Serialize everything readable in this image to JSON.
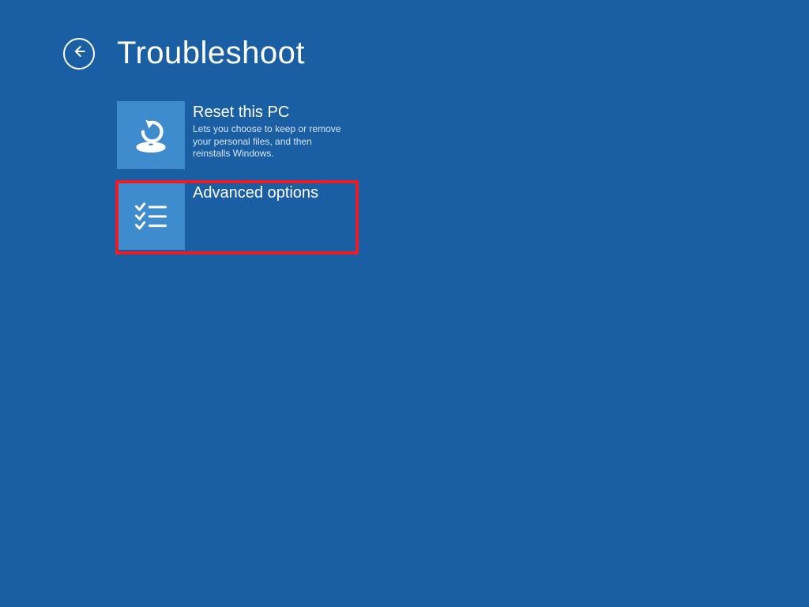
{
  "header": {
    "title": "Troubleshoot"
  },
  "tiles": [
    {
      "id": "reset-this-pc",
      "title": "Reset this PC",
      "description": "Lets you choose to keep or remove your personal files, and then reinstalls Windows.",
      "icon": "reset-icon",
      "highlighted": false
    },
    {
      "id": "advanced-options",
      "title": "Advanced options",
      "description": "",
      "icon": "checklist-icon",
      "highlighted": true
    }
  ],
  "annotation": {
    "highlight_color": "#ed1c24"
  },
  "colors": {
    "background": "#1a5fa3",
    "tile_icon_bg": "#3e8bce",
    "text": "#ffffff",
    "text_secondary": "#d8e6f5"
  }
}
